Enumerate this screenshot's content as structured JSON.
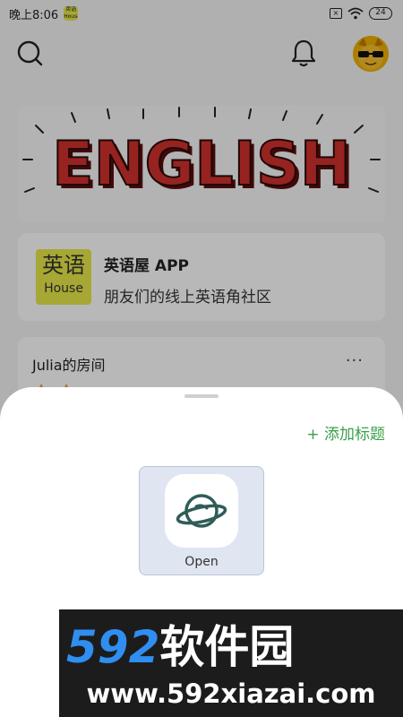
{
  "status_bar": {
    "time": "晚上8:06",
    "app_icon_text": "英语House",
    "battery": "24"
  },
  "header": {
    "search_icon": "search-icon",
    "bell_icon": "bell-icon",
    "avatar": "cat-avatar-with-sunglasses"
  },
  "banner": {
    "text": "ENGLISH"
  },
  "app_card": {
    "logo_cn": "英语",
    "logo_en": "House",
    "name": "英语屋 APP",
    "description": "朋友们的线上英语角社区"
  },
  "room_card": {
    "title": "Julia的房间",
    "more": "···"
  },
  "sheet": {
    "add_title": "+ 添加标题",
    "open_label": "Open",
    "open_icon": "planet-icon",
    "hint": ""
  },
  "watermark": {
    "number": "592",
    "cn": "软件园",
    "url": "www.592xiazai.com"
  },
  "colors": {
    "accent_green": "#3aa04a",
    "logo_yellow": "#e8e84a",
    "banner_red": "#d0312d",
    "watermark_blue": "#2f8ef0"
  }
}
